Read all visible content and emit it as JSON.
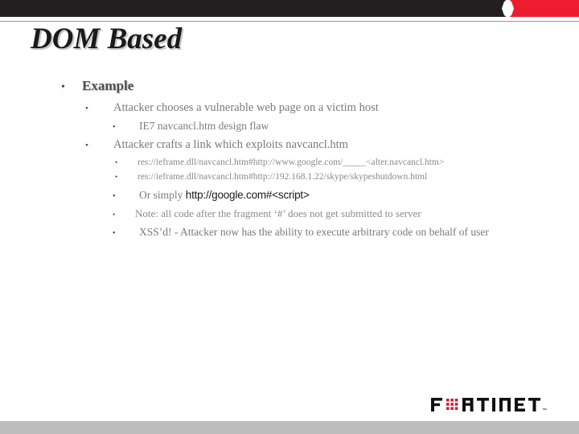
{
  "slide": {
    "title": "DOM Based",
    "bullet_glyph": "•"
  },
  "colors": {
    "header_black": "#231f20",
    "header_red": "#ed1c2e",
    "bullet_red": "#8c2232",
    "body_gray": "#7a7a7a",
    "footer_gray": "#bcbcbc",
    "logo_red": "#cf1f2e"
  },
  "content": {
    "level1": "Example",
    "items": [
      {
        "level": 2,
        "text": "Attacker chooses a vulnerable web page on a victim host"
      },
      {
        "level": 3,
        "text": "IE7 navcancl.htm design flaw"
      },
      {
        "level": 2,
        "text": "Attacker crafts a link which exploits navcancl.htm"
      },
      {
        "level": 4,
        "text": "res://ieframe.dll/navcancl.htm#http://www.google.com/_____<alter.navcancl.htm>"
      },
      {
        "level": 4,
        "text": "res://ieframe.dll/navcancl.htm#http://192.168.1.22/skype/skypeshutdown.html"
      }
    ],
    "or_simply": {
      "prefix": "Or simply ",
      "url": "http://google.com#<script>"
    },
    "note": "Note: all code after the fragment ‘#’ does not get submitted to server",
    "xssd": "XSS’d!  - Attacker now has the ability to execute arbitrary code on behalf of user"
  },
  "footer": {
    "logo_text_left": "F",
    "logo_text_right": "RTINET",
    "logo_tm": "™"
  }
}
